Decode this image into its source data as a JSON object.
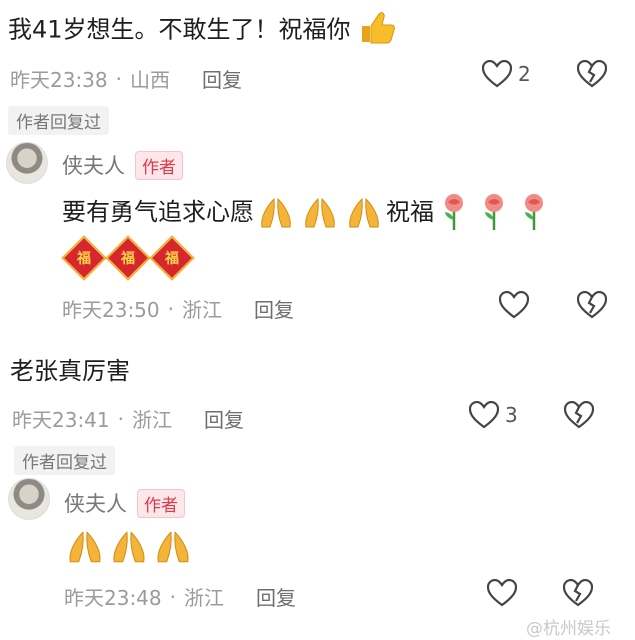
{
  "comments": [
    {
      "text": "我41岁想生。不敢生了！祝福你",
      "time": "昨天23:38",
      "location": "山西",
      "reply_label": "回复",
      "likes": "2",
      "author_replied_label": "作者回复过",
      "reply": {
        "author": "侠夫人",
        "badge": "作者",
        "text": "要有勇气追求心愿",
        "text_tail": "祝福",
        "fu_char": "福",
        "time": "昨天23:50",
        "location": "浙江",
        "reply_label": "回复"
      }
    },
    {
      "text": "老张真厉害",
      "time": "昨天23:41",
      "location": "浙江",
      "reply_label": "回复",
      "likes": "3",
      "author_replied_label": "作者回复过",
      "reply": {
        "author": "侠夫人",
        "badge": "作者",
        "time": "昨天23:48",
        "location": "浙江",
        "reply_label": "回复"
      }
    }
  ],
  "meta_separator": "·",
  "watermark": "@杭州娱乐",
  "icons": [
    "heart-icon",
    "broken-heart-icon",
    "thumbs-up-emoji",
    "pray-emoji",
    "rose-emoji",
    "fu-emoji"
  ]
}
